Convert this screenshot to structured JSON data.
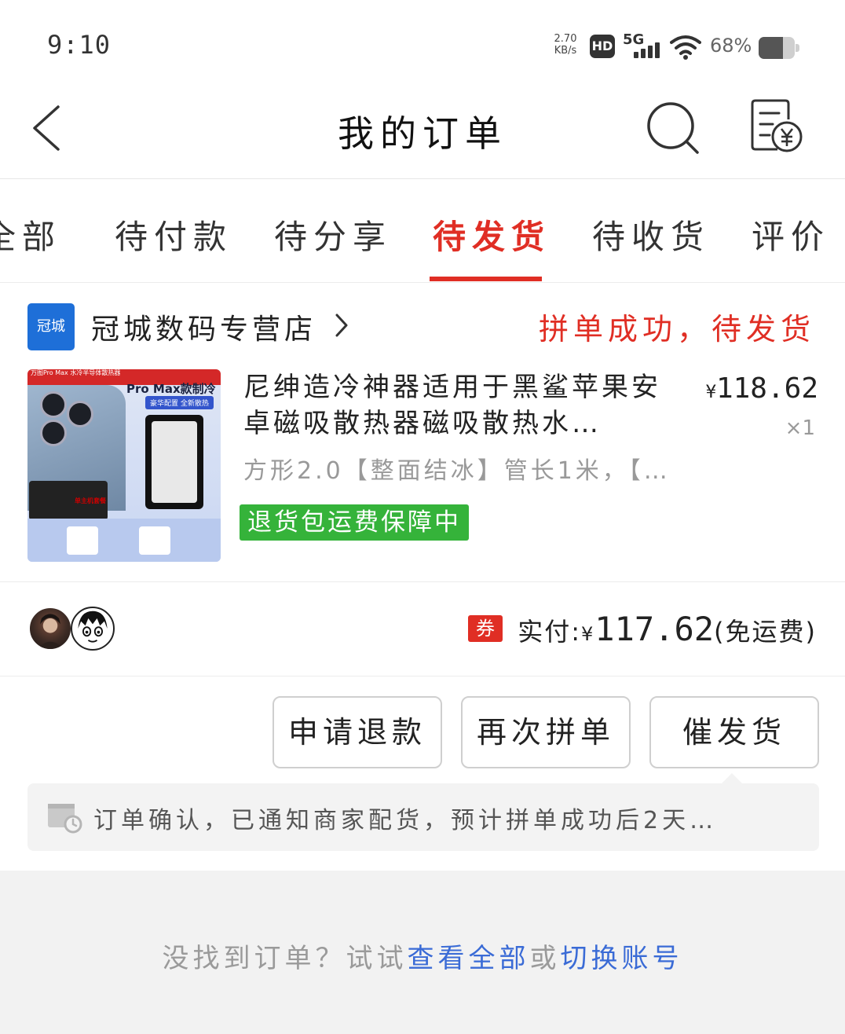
{
  "status_bar": {
    "time": "9:10",
    "net_speed_value": "2.70",
    "net_speed_unit": "KB/s",
    "hd_label": "HD",
    "network_label": "5G",
    "battery_percent": "68%",
    "battery_level": 0.68
  },
  "header": {
    "title": "我的订单"
  },
  "tabs": [
    {
      "label": "全部"
    },
    {
      "label": "待付款"
    },
    {
      "label": "待分享"
    },
    {
      "label": "待发货"
    },
    {
      "label": "待收货"
    },
    {
      "label": "评价"
    }
  ],
  "active_tab": "待发货",
  "order": {
    "store_logo_text": "冠城",
    "store_name": "冠城数码专营店",
    "status": "拼单成功，待发货",
    "product": {
      "title": "尼绅造冷神器适用于黑鲨苹果安卓磁吸散热器磁吸散热水…",
      "price_symbol": "¥",
      "price_value": "118.62",
      "quantity": "×1",
      "spec": "方形2.0【整面结冰】管长1米，【…",
      "guarantee_badge": "退货包运费保障中",
      "image_text": {
        "banner": "万图Pro Max 水冷半导体散热器",
        "headline": "Pro Max款制冷",
        "badge": "豪华配置 全新散热",
        "caption": "单主机套餐"
      }
    },
    "coupon_label": "券",
    "paid_label": "实付:",
    "paid_symbol": "¥",
    "paid_value": "117.62",
    "paid_note": "(免运费)",
    "buttons": {
      "refund": "申请退款",
      "regroup": "再次拼单",
      "urge": "催发货"
    },
    "notice": "订单确认，已通知商家配货，预计拼单成功后2天…"
  },
  "footer": {
    "prefix": "没找到订单？试试",
    "link_all": "查看全部",
    "or": "或",
    "link_switch": "切换账号"
  },
  "colors": {
    "accent": "#e02e24",
    "guarantee": "#35b33a",
    "link": "#3a6bd6",
    "store_logo": "#1e6fd8"
  }
}
